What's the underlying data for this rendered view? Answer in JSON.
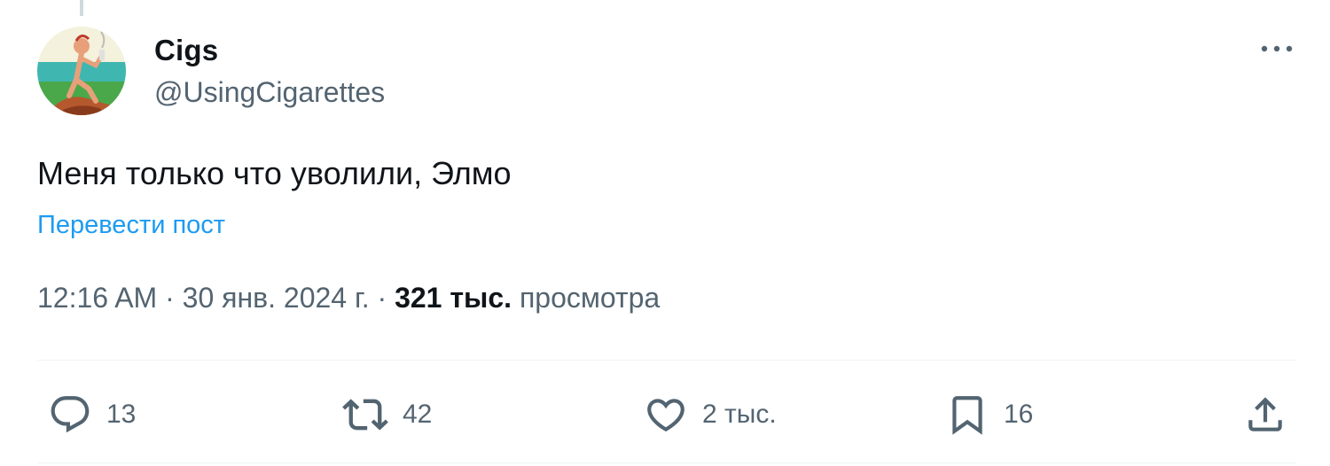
{
  "author": {
    "display_name": "Cigs",
    "handle": "@UsingCigarettes",
    "avatar_icon": "avatar-image"
  },
  "post": {
    "text": "Меня только что уволили, Элмо",
    "translate_label": "Перевести пост"
  },
  "meta": {
    "time": "12:16 AM",
    "separator": "·",
    "date": "30 янв. 2024 г.",
    "views_count": "321 тыс.",
    "views_label": "просмотра"
  },
  "actions": {
    "replies": "13",
    "reposts": "42",
    "likes": "2 тыс.",
    "bookmarks": "16"
  },
  "colors": {
    "accent": "#1d9bf0",
    "secondary_text": "#536471",
    "primary_text": "#0f1419",
    "divider": "#eff3f4"
  }
}
